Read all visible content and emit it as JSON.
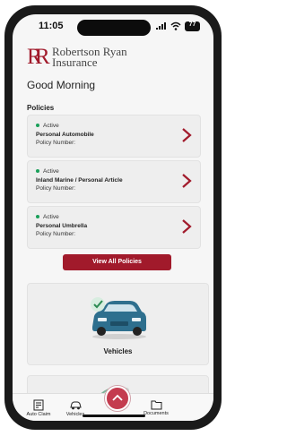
{
  "status_bar": {
    "time": "11:05",
    "battery": "77"
  },
  "brand": {
    "line1": "Robertson Ryan",
    "line2": "Insurance",
    "accent": "#a11a2b"
  },
  "greeting": "Good Morning",
  "policies": {
    "heading": "Policies",
    "items": [
      {
        "status": "Active",
        "title": "Personal Automobile",
        "policy_label": "Policy Number:"
      },
      {
        "status": "Active",
        "title": "Inland Marine / Personal Article",
        "policy_label": "Policy Number:"
      },
      {
        "status": "Active",
        "title": "Personal Umbrella",
        "policy_label": "Policy Number:"
      }
    ],
    "view_all_label": "View All Policies"
  },
  "vehicles_card": {
    "label": "Vehicles",
    "icon": "car-with-checkmark-icon"
  },
  "tabbar": {
    "items": [
      {
        "label": "Auto Claim",
        "icon": "claim-document-icon"
      },
      {
        "label": "Vehicles",
        "icon": "car-icon"
      },
      {
        "label": "",
        "icon": "chevron-up-icon"
      },
      {
        "label": "Documents",
        "icon": "folder-icon"
      }
    ]
  }
}
